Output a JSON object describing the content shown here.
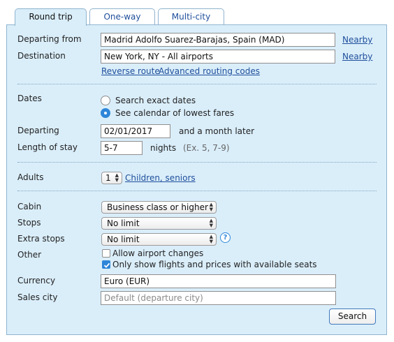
{
  "tabs": [
    {
      "label": "Round trip",
      "active": true
    },
    {
      "label": "One-way",
      "active": false
    },
    {
      "label": "Multi-city",
      "active": false
    }
  ],
  "route": {
    "departing_from_label": "Departing from",
    "departing_from_value": "Madrid Adolfo Suarez-Barajas, Spain (MAD)",
    "destination_label": "Destination",
    "destination_value": "New York, NY - All airports",
    "nearby_label": "Nearby",
    "reverse_route": "Reverse route",
    "advanced_routing": "Advanced routing codes"
  },
  "dates": {
    "label": "Dates",
    "options": [
      {
        "label": "Search exact dates",
        "selected": false
      },
      {
        "label": "See calendar of lowest fares",
        "selected": true
      }
    ],
    "departing_label": "Departing",
    "departing_value": "02/01/2017",
    "departing_suffix": "and a month later",
    "length_label": "Length of stay",
    "length_value": "5-7",
    "length_unit": "nights",
    "length_hint": "(Ex. 5, 7-9)"
  },
  "passengers": {
    "adults_label": "Adults",
    "adults_value": "1",
    "children_link": "Children, seniors"
  },
  "options": {
    "cabin_label": "Cabin",
    "cabin_value": "Business class or higher",
    "stops_label": "Stops",
    "stops_value": "No limit",
    "extra_stops_label": "Extra stops",
    "extra_stops_value": "No limit",
    "help_glyph": "?",
    "other_label": "Other",
    "allow_airport_changes": {
      "label": "Allow airport changes",
      "checked": false
    },
    "only_available": {
      "label": "Only show flights and prices with available seats",
      "checked": true
    },
    "currency_label": "Currency",
    "currency_value": "Euro (EUR)",
    "sales_city_label": "Sales city",
    "sales_city_placeholder": "Default (departure city)"
  },
  "search_button": "Search",
  "colors": {
    "panel_bg": "#daeefa",
    "border": "#8fb4cf",
    "link": "#1e4e9b",
    "accent": "#2e86d9"
  }
}
